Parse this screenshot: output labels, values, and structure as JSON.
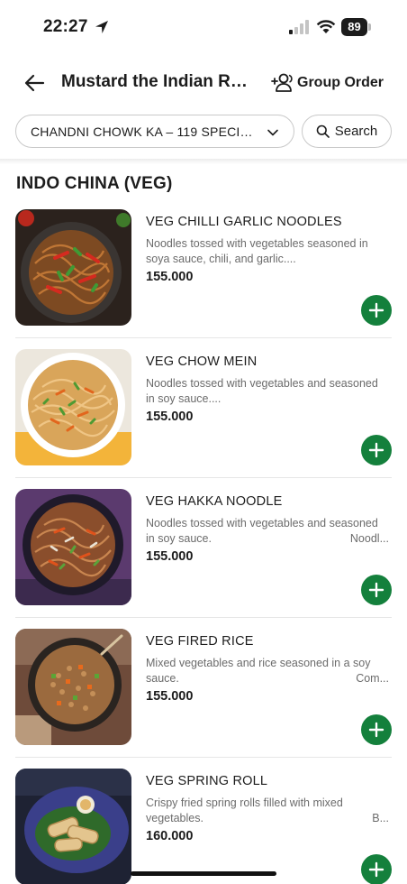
{
  "status": {
    "time": "22:27",
    "battery": "89"
  },
  "header": {
    "title": "Mustard the Indian Re...",
    "group_order": "Group Order"
  },
  "filter": {
    "category": "CHANDNI CHOWK KA – 119 SPECIAL...",
    "search_label": "Search"
  },
  "section": {
    "title": "INDO CHINA (VEG)"
  },
  "items": [
    {
      "name": "VEG CHILLI GARLIC NOODLES",
      "desc1": "Noodles tossed with vegetables seasoned in",
      "desc2": "soya sauce, chili, and garlic....",
      "desc2_right": "",
      "price": "155.000"
    },
    {
      "name": "VEG CHOW MEIN",
      "desc1": "Noodles tossed with vegetables and seasoned",
      "desc2": "in soy sauce....",
      "desc2_right": "",
      "price": "155.000"
    },
    {
      "name": "VEG HAKKA NOODLE",
      "desc1": "Noodles tossed with vegetables and seasoned",
      "desc2": "in soy sauce.",
      "desc2_right": "Noodl...",
      "price": "155.000"
    },
    {
      "name": "VEG FIRED RICE",
      "desc1": "Mixed vegetables and rice seasoned in a soy",
      "desc2": "sauce.",
      "desc2_right": "Com...",
      "price": "155.000"
    },
    {
      "name": "VEG SPRING ROLL",
      "desc1": "Crispy fried spring rolls filled with mixed",
      "desc2": "vegetables.",
      "desc2_right": "B...",
      "price": "160.000"
    }
  ],
  "icons": {
    "back": "arrow-left-icon",
    "group": "group-people-icon",
    "chevron": "chevron-down-icon",
    "search": "search-icon",
    "add": "plus-icon"
  },
  "colors": {
    "add_button": "#14803c",
    "text": "#1c1c1c",
    "muted": "#6b6b6b"
  }
}
